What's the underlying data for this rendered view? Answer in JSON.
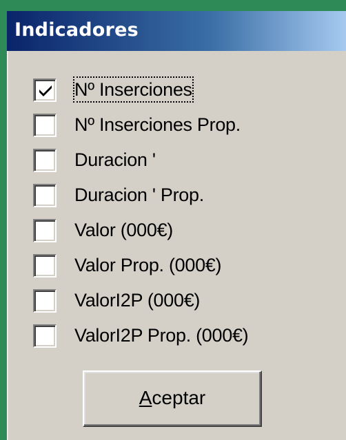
{
  "window": {
    "title": "Indicadores"
  },
  "options": [
    {
      "label": "Nº Inserciones",
      "checked": true,
      "focused": true
    },
    {
      "label": "Nº Inserciones Prop.",
      "checked": false,
      "focused": false
    },
    {
      "label": "Duracion '",
      "checked": false,
      "focused": false
    },
    {
      "label": "Duracion ' Prop.",
      "checked": false,
      "focused": false
    },
    {
      "label": "Valor (000€)",
      "checked": false,
      "focused": false
    },
    {
      "label": "Valor Prop. (000€)",
      "checked": false,
      "focused": false
    },
    {
      "label": "ValorI2P (000€)",
      "checked": false,
      "focused": false
    },
    {
      "label": "ValorI2P Prop. (000€)",
      "checked": false,
      "focused": false
    }
  ],
  "accept_button": {
    "mnemonic": "A",
    "rest": "ceptar"
  },
  "colors": {
    "desktop": "#2e8b57",
    "title_gradient_start": "#0a246a",
    "title_gradient_end": "#a6caf0",
    "dialog_face": "#d4d0c8"
  }
}
